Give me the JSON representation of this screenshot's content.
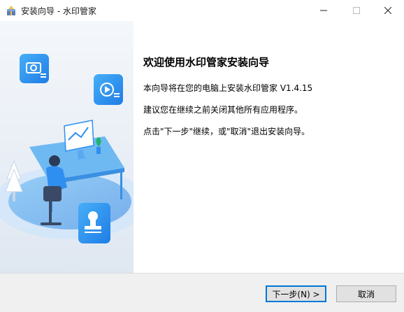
{
  "window": {
    "title": "安装向导 - 水印管家",
    "icon": "installer-box-icon"
  },
  "controls": {
    "minimize_icon": "minimize-icon",
    "maximize_icon": "maximize-icon",
    "close_icon": "close-icon"
  },
  "main": {
    "heading": "欢迎使用水印管家安装向导",
    "line1": "本向导将在您的电脑上安装水印管家 V1.4.15",
    "line2": "建议您在继续之前关闭其他所有应用程序。",
    "line3": "点击\"下一步\"继续，或\"取消\"退出安装向导。"
  },
  "buttons": {
    "next": "下一步(N) >",
    "cancel": "取消"
  },
  "colors": {
    "accent": "#0078d7",
    "illustration_blue": "#2f8ff0",
    "illustration_light": "#e8eef5"
  }
}
